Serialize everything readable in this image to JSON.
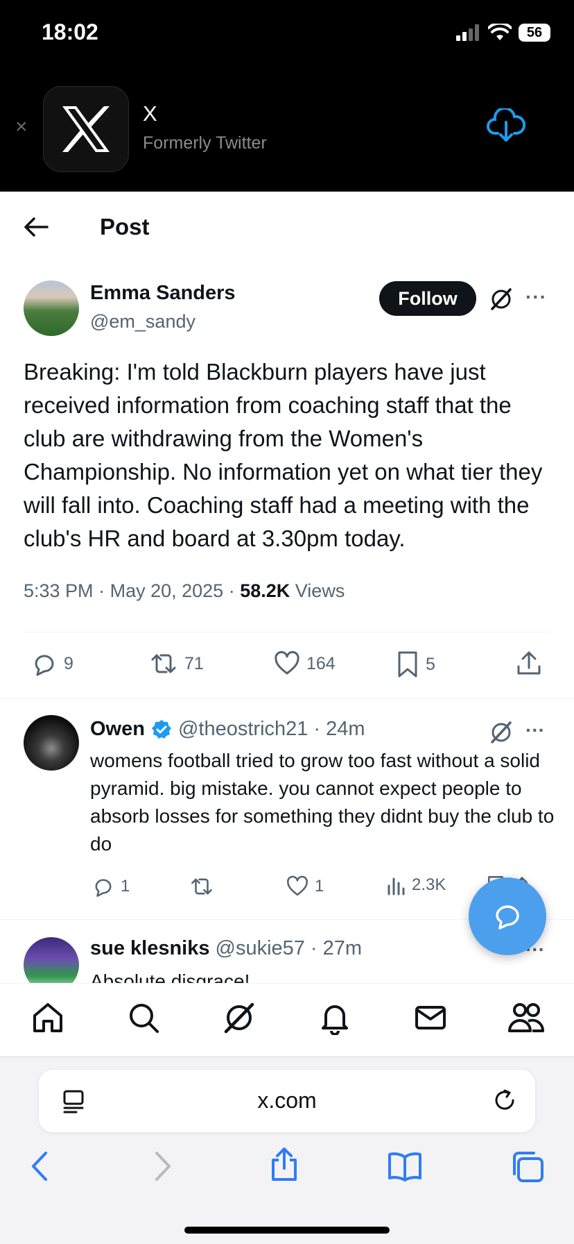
{
  "status_bar": {
    "time": "18:02",
    "battery": "56"
  },
  "app_banner": {
    "app_name": "X",
    "subtitle": "Formerly Twitter",
    "close_label": "×"
  },
  "header": {
    "title": "Post"
  },
  "tweet": {
    "author_name": "Emma Sanders",
    "author_handle": "@em_sandy",
    "follow_label": "Follow",
    "more_label": "···",
    "text": "Breaking: I'm told Blackburn players have just received information from coaching staff that the club are withdrawing from the Women's Championship. No information yet on what tier they will fall into. Coaching staff had a meeting with the club's HR and board at 3.30pm today.",
    "time": "5:33 PM",
    "date": "May 20, 2025",
    "views_count": "58.2K",
    "views_label": "Views",
    "replies": "9",
    "reposts": "71",
    "likes": "164",
    "bookmarks": "5"
  },
  "replies": [
    {
      "name": "Owen",
      "verified": true,
      "handle": "@theostrich21",
      "time": "· 24m",
      "text": "womens football tried to grow too fast without a solid pyramid. big mistake. you cannot expect people to absorb losses for something they didnt buy the club to do",
      "replies": "1",
      "reposts": "",
      "likes": "1",
      "views": "2.3K"
    },
    {
      "name": "sue klesniks",
      "handle": "@sukie57",
      "time": "· 27m",
      "text": "Absolute disgrace!"
    }
  ],
  "safari": {
    "url": "x.com"
  },
  "icons": {
    "accent": "#1d9bf0",
    "fab_color": "#4c9fed",
    "safari_blue": "#2f7cf6"
  }
}
